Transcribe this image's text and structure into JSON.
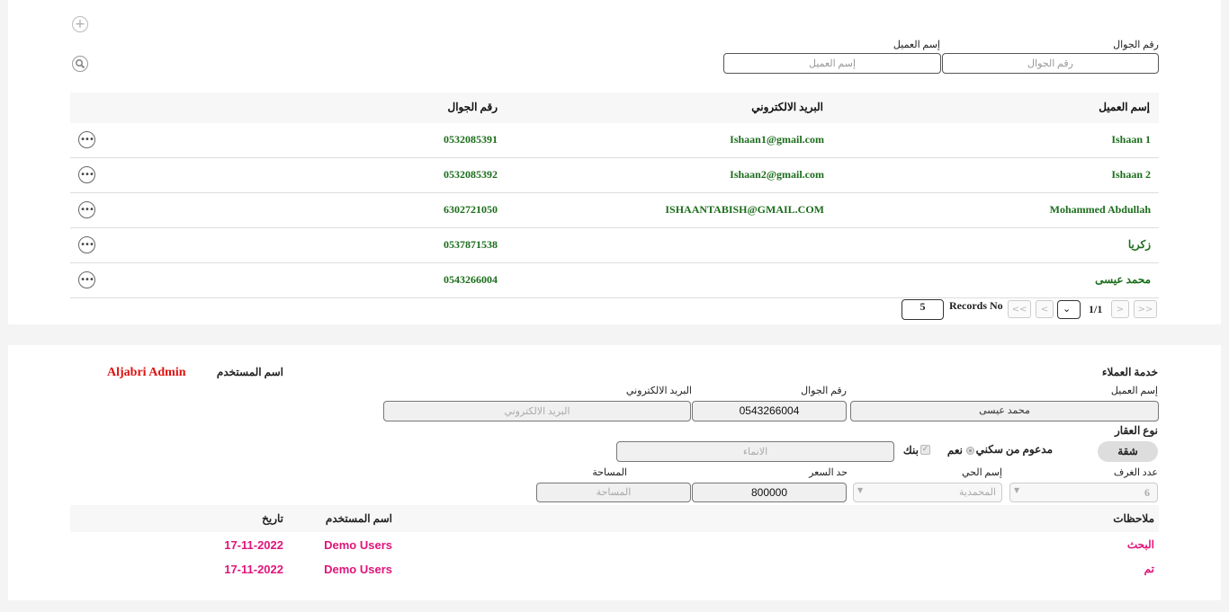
{
  "search": {
    "add_icon": "plus-circle-icon",
    "search_icon": "magnifier-icon",
    "phone_label": "رقم الجوال",
    "phone_placeholder": "رقم الجوال",
    "name_label": "إسم العميل",
    "name_placeholder": "إسم العميل"
  },
  "table": {
    "columns": {
      "name": "إسم العميل",
      "email": "البريد الالكتروني",
      "phone": "رقم الجوال"
    },
    "rows": [
      {
        "name": "Ishaan 1",
        "email": "Ishaan1@gmail.com",
        "phone": "0532085391"
      },
      {
        "name": "Ishaan 2",
        "email": "Ishaan2@gmail.com",
        "phone": "0532085392"
      },
      {
        "name": "Mohammed Abdullah",
        "email": "ISHAANTABISH@GMAIL.COM",
        "phone": "6302721050"
      },
      {
        "name": "زكريا",
        "email": "",
        "phone": "0537871538"
      },
      {
        "name": "محمد عيسى",
        "email": "",
        "phone": "0543266004"
      }
    ],
    "row_action_icon": "more-options-icon"
  },
  "pagination": {
    "first": ">>",
    "prev": ">",
    "page": "1/1",
    "next": "<",
    "last": "<<",
    "records_label": "Records No",
    "records_value": "5"
  },
  "detail": {
    "section_title": "خدمة العملاء",
    "user_label": "اسم المستخدم",
    "user_value": "Aljabri Admin",
    "customer_name_label": "إسم العميل",
    "customer_name_value": "محمد عيسى",
    "phone_label": "رقم الجوال",
    "phone_value": "0543266004",
    "email_label": "البريد الالكتروني",
    "email_placeholder": "البريد الالكتروني",
    "property_type_label": "نوع العقار",
    "property_type_value": "شقة",
    "housing_support_label": "مدعوم من سكني",
    "yes_label": "نعم",
    "bank_label": "بنك",
    "construction_placeholder": "الانماء",
    "rooms_label": "عدد الغرف",
    "rooms_value": "6",
    "district_label": "إسم الحي",
    "district_value": "المحمدية",
    "price_label": "حد السعر",
    "price_value": "800000",
    "area_label": "المساحة",
    "area_placeholder": "المساحة"
  },
  "notes": {
    "columns": {
      "notes": "ملاحظات",
      "user": "اسم المستخدم",
      "date": "تاريخ"
    },
    "rows": [
      {
        "note": "البحث",
        "user": "Demo Users",
        "date": "17-11-2022"
      },
      {
        "note": "تم",
        "user": "Demo Users",
        "date": "17-11-2022"
      }
    ]
  },
  "colors": {
    "name_green": "#1b6d1b",
    "admin_red": "#e01010",
    "notes_pink": "#e0157a"
  }
}
